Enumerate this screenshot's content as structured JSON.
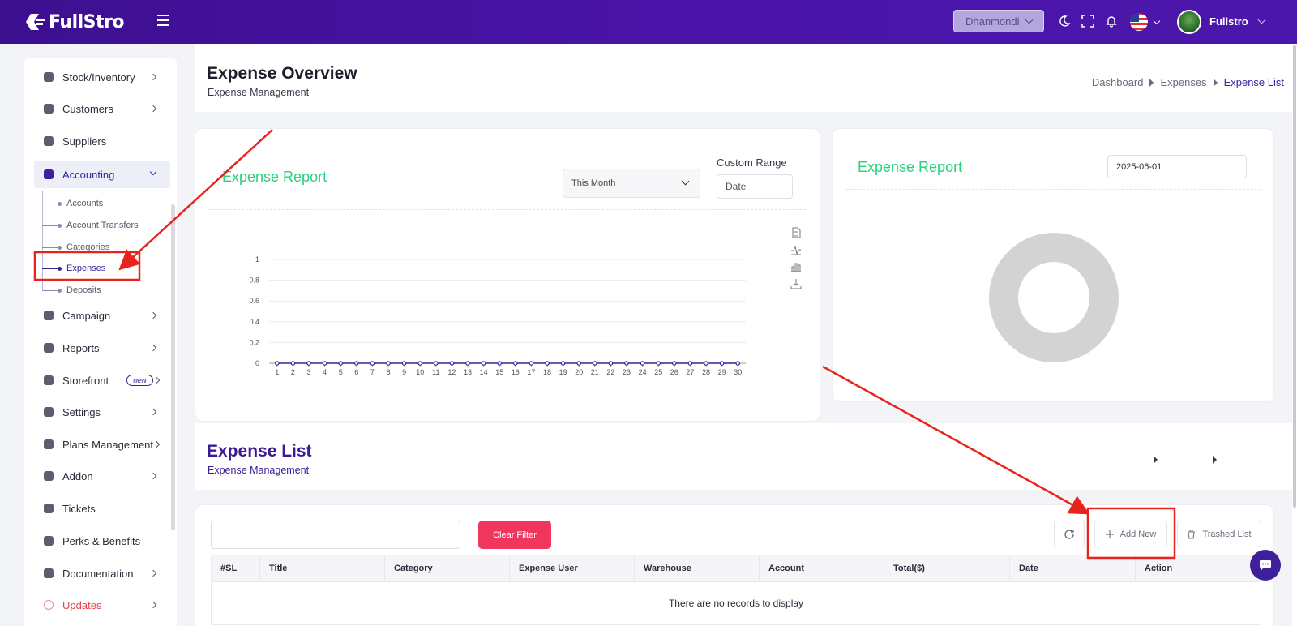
{
  "topbar": {
    "logo_text": "FullStro",
    "branch": "Dhanmondi",
    "username": "Fullstro",
    "icons": [
      "menu-icon",
      "moon-icon",
      "fullscreen-icon",
      "bell-icon",
      "us-flag-icon",
      "avatar"
    ]
  },
  "sidebar": {
    "items": [
      {
        "label": "Stock/Inventory",
        "icon": "box-icon"
      },
      {
        "label": "Customers",
        "icon": "users-icon"
      },
      {
        "label": "Suppliers",
        "icon": "supplier-icon"
      },
      {
        "label": "Accounting",
        "icon": "wallet-icon"
      },
      {
        "label": "Campaign",
        "icon": "campaign-icon"
      },
      {
        "label": "Reports",
        "icon": "report-icon"
      },
      {
        "label": "Storefront",
        "icon": "store-icon",
        "badge": "new"
      },
      {
        "label": "Settings",
        "icon": "gear-icon"
      },
      {
        "label": "Plans Management",
        "icon": "plans-icon"
      },
      {
        "label": "Addon",
        "icon": "addon-icon"
      },
      {
        "label": "Tickets",
        "icon": "ticket-icon"
      },
      {
        "label": "Perks & Benefits",
        "icon": "perks-icon"
      },
      {
        "label": "Documentation",
        "icon": "doc-icon"
      },
      {
        "label": "Updates",
        "icon": "updates-icon"
      }
    ],
    "accounting_sub": [
      "Accounts",
      "Account Transfers",
      "Categories",
      "Expenses",
      "Deposits"
    ]
  },
  "header": {
    "title": "Expense Overview",
    "subtitle": "Expense Management",
    "breadcrumb": [
      "Dashboard",
      "Expenses",
      "Expense List"
    ]
  },
  "report_left": {
    "title": "Expense Report",
    "period": "This Month",
    "custom_range_label": "Custom Range",
    "date_placeholder": "Date"
  },
  "report_right": {
    "title": "Expense Report",
    "date": "2025-06-01"
  },
  "chart_data": {
    "type": "line",
    "x": [
      1,
      2,
      3,
      4,
      5,
      6,
      7,
      8,
      9,
      10,
      11,
      12,
      13,
      14,
      15,
      16,
      17,
      18,
      19,
      20,
      21,
      22,
      23,
      24,
      25,
      26,
      27,
      28,
      29,
      30
    ],
    "series": [
      {
        "values": [
          0,
          0,
          0,
          0,
          0,
          0,
          0,
          0,
          0,
          0,
          0,
          0,
          0,
          0,
          0,
          0,
          0,
          0,
          0,
          0,
          0,
          0,
          0,
          0,
          0,
          0,
          0,
          0,
          0,
          0
        ]
      }
    ],
    "yticks": [
      "0",
      "0.2",
      "0.4",
      "0.6",
      "0.8",
      "1"
    ],
    "ylim": [
      0,
      1
    ],
    "color": "#3e1f9c",
    "toolbar_icons": [
      "document-icon",
      "line-chart-icon",
      "bar-chart-icon",
      "download-icon"
    ]
  },
  "list": {
    "title": "Expense List",
    "subtitle": "Expense Management",
    "clear_filter": "Clear Filter",
    "add_new": "Add New",
    "trashed_list": "Trashed List",
    "columns": [
      "#SL",
      "Title",
      "Category",
      "Expense User",
      "Warehouse",
      "Account",
      "Total($)",
      "Date",
      "Action"
    ],
    "empty_message": "There are no records to display"
  },
  "colors": {
    "brand": "#4a14a8",
    "accent_green": "#29d07d",
    "danger": "#f0365c",
    "annotation": "#e8231b"
  }
}
